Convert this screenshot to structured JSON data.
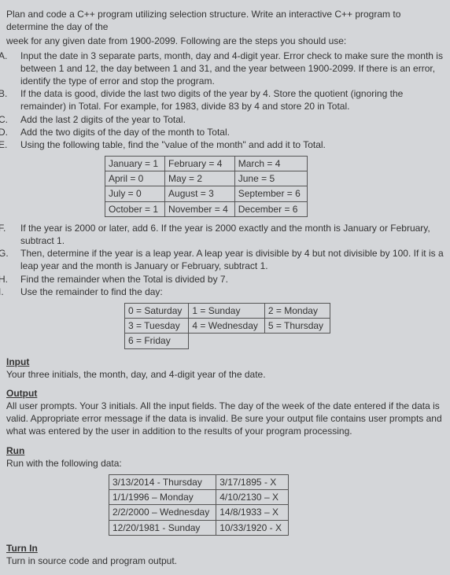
{
  "intro1": "Plan and code a C++ program utilizing selection structure. Write an interactive C++ program to determine the day of the",
  "intro2": "week for any given date from 1900-2099. Following are the steps you should use:",
  "steps": {
    "A": "Input the date in 3 separate parts, month, day and 4-digit year. Error check to make sure the month is between 1 and 12, the day between 1 and 31, and the year between 1900-2099. If there is an error, identify the type of error and stop the program.",
    "B": "If the data is good, divide the last two digits of the year by 4. Store the quotient (ignoring the remainder) in Total. For example, for 1983, divide 83 by 4 and store 20 in Total.",
    "C": "Add the last 2 digits of the year to Total.",
    "D": "Add the two digits of the day of the month to Total.",
    "E": "Using the following table, find the \"value of the month\" and add it to Total."
  },
  "monthTable": [
    [
      "January = 1",
      "February = 4",
      "March = 4"
    ],
    [
      "April = 0",
      "May = 2",
      "June = 5"
    ],
    [
      "July = 0",
      "August = 3",
      "September = 6"
    ],
    [
      "October = 1",
      "November = 4",
      "December = 6"
    ]
  ],
  "steps2": {
    "F": "If the year is 2000 or later, add 6. If the year is 2000 exactly and the month is January or February, subtract 1.",
    "G": "Then, determine if the year is a leap year. A leap year is divisible by 4 but not divisible by 100. If it is a leap year and the month is January or February, subtract 1.",
    "H": "Find the remainder when the Total is divided by 7.",
    "I": "Use the remainder to find the day:"
  },
  "dayTable": [
    [
      "0 = Saturday",
      "1 = Sunday",
      "2 = Monday"
    ],
    [
      "3 = Tuesday",
      "4 = Wednesday",
      "5 = Thursday"
    ],
    [
      "6 = Friday",
      "",
      ""
    ]
  ],
  "inputHead": "Input",
  "inputBody": "Your three initials, the month, day, and 4-digit year of the date.",
  "outputHead": "Output",
  "outputBody": "All user prompts. Your 3 initials. All the input fields. The day of the week of the date entered if the data is valid. Appropriate error message if the data is invalid. Be sure your output file contains user prompts and what was entered by the user in addition to the results of your program processing.",
  "runHead": "Run",
  "runBody": "Run with the following data:",
  "runTable": [
    [
      "3/13/2014 - Thursday",
      "3/17/1895 - X"
    ],
    [
      "1/1/1996 – Monday",
      "4/10/2130 – X"
    ],
    [
      "2/2/2000 – Wednesday",
      "14/8/1933 – X"
    ],
    [
      "12/20/1981 - Sunday",
      "10/33/1920 - X"
    ]
  ],
  "turnHead": "Turn In",
  "turnBody": "Turn in source code and program output."
}
